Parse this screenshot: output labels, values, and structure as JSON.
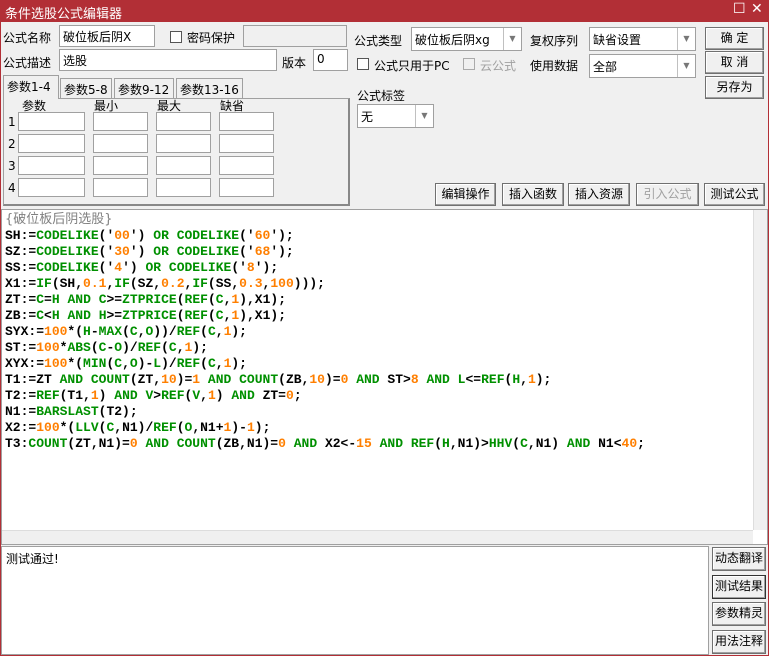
{
  "window": {
    "title": "条件选股公式编辑器"
  },
  "form": {
    "name_label": "公式名称",
    "name_value": "破位板后阴X",
    "password_label": "密码保护",
    "desc_label": "公式描述",
    "desc_value": "选股",
    "version_label": "版本",
    "version_value": "0",
    "type_label": "公式类型",
    "type_value": "破位板后阴xg",
    "pc_only_label": "公式只用于PC",
    "cloud_label": "云公式",
    "rights_label": "复权序列",
    "rights_value": "缺省设置",
    "data_label": "使用数据",
    "data_value": "全部",
    "tag_label": "公式标签",
    "tag_value": "无"
  },
  "buttons": {
    "ok": "确  定",
    "cancel": "取  消",
    "save_as": "另存为",
    "edit_ops": "编辑操作",
    "insert_func": "插入函数",
    "insert_res": "插入资源",
    "import": "引入公式",
    "test": "测试公式"
  },
  "params": {
    "tabs": [
      "参数1-4",
      "参数5-8",
      "参数9-12",
      "参数13-16"
    ],
    "headers": [
      "参数",
      "最小",
      "最大",
      "缺省"
    ],
    "rows": [
      "1",
      "2",
      "3",
      "4"
    ]
  },
  "editor": {
    "lines": [
      [
        [
          "{破位板后阴选股}",
          "c"
        ]
      ],
      [
        [
          "SH:=",
          "d"
        ],
        [
          "CODELIKE",
          "f"
        ],
        [
          "('",
          "d"
        ],
        [
          "00",
          "n"
        ],
        [
          "') ",
          "d"
        ],
        [
          "OR",
          "f"
        ],
        [
          " ",
          "d"
        ],
        [
          "CODELIKE",
          "f"
        ],
        [
          "('",
          "d"
        ],
        [
          "60",
          "n"
        ],
        [
          "');",
          "d"
        ]
      ],
      [
        [
          "SZ:=",
          "d"
        ],
        [
          "CODELIKE",
          "f"
        ],
        [
          "('",
          "d"
        ],
        [
          "30",
          "n"
        ],
        [
          "') ",
          "d"
        ],
        [
          "OR",
          "f"
        ],
        [
          " ",
          "d"
        ],
        [
          "CODELIKE",
          "f"
        ],
        [
          "('",
          "d"
        ],
        [
          "68",
          "n"
        ],
        [
          "');",
          "d"
        ]
      ],
      [
        [
          "SS:=",
          "d"
        ],
        [
          "CODELIKE",
          "f"
        ],
        [
          "('",
          "d"
        ],
        [
          "4",
          "n"
        ],
        [
          "') ",
          "d"
        ],
        [
          "OR",
          "f"
        ],
        [
          " ",
          "d"
        ],
        [
          "CODELIKE",
          "f"
        ],
        [
          "('",
          "d"
        ],
        [
          "8",
          "n"
        ],
        [
          "');",
          "d"
        ]
      ],
      [
        [
          "X1:=",
          "d"
        ],
        [
          "IF",
          "f"
        ],
        [
          "(SH,",
          "d"
        ],
        [
          "0.1",
          "n"
        ],
        [
          ",",
          "d"
        ],
        [
          "IF",
          "f"
        ],
        [
          "(SZ,",
          "d"
        ],
        [
          "0.2",
          "n"
        ],
        [
          ",",
          "d"
        ],
        [
          "IF",
          "f"
        ],
        [
          "(SS,",
          "d"
        ],
        [
          "0.3",
          "n"
        ],
        [
          ",",
          "d"
        ],
        [
          "100",
          "n"
        ],
        [
          ")));",
          "d"
        ]
      ],
      [
        [
          "ZT:=",
          "d"
        ],
        [
          "C",
          "f"
        ],
        [
          "=",
          "d"
        ],
        [
          "H",
          "f"
        ],
        [
          " ",
          "d"
        ],
        [
          "AND",
          "f"
        ],
        [
          " ",
          "d"
        ],
        [
          "C",
          "f"
        ],
        [
          ">=",
          "d"
        ],
        [
          "ZTPRICE",
          "f"
        ],
        [
          "(",
          "d"
        ],
        [
          "REF",
          "f"
        ],
        [
          "(",
          "d"
        ],
        [
          "C",
          "f"
        ],
        [
          ",",
          "d"
        ],
        [
          "1",
          "n"
        ],
        [
          "),X1);",
          "d"
        ]
      ],
      [
        [
          "ZB:=",
          "d"
        ],
        [
          "C",
          "f"
        ],
        [
          "<",
          "d"
        ],
        [
          "H",
          "f"
        ],
        [
          " ",
          "d"
        ],
        [
          "AND",
          "f"
        ],
        [
          " ",
          "d"
        ],
        [
          "H",
          "f"
        ],
        [
          ">=",
          "d"
        ],
        [
          "ZTPRICE",
          "f"
        ],
        [
          "(",
          "d"
        ],
        [
          "REF",
          "f"
        ],
        [
          "(",
          "d"
        ],
        [
          "C",
          "f"
        ],
        [
          ",",
          "d"
        ],
        [
          "1",
          "n"
        ],
        [
          "),X1);",
          "d"
        ]
      ],
      [
        [
          "SYX:=",
          "d"
        ],
        [
          "100",
          "n"
        ],
        [
          "*(",
          "d"
        ],
        [
          "H",
          "f"
        ],
        [
          "-",
          "d"
        ],
        [
          "MAX",
          "f"
        ],
        [
          "(",
          "d"
        ],
        [
          "C",
          "f"
        ],
        [
          ",",
          "d"
        ],
        [
          "O",
          "f"
        ],
        [
          "))/",
          "d"
        ],
        [
          "REF",
          "f"
        ],
        [
          "(",
          "d"
        ],
        [
          "C",
          "f"
        ],
        [
          ",",
          "d"
        ],
        [
          "1",
          "n"
        ],
        [
          ");",
          "d"
        ]
      ],
      [
        [
          "ST:=",
          "d"
        ],
        [
          "100",
          "n"
        ],
        [
          "*",
          "d"
        ],
        [
          "ABS",
          "f"
        ],
        [
          "(",
          "d"
        ],
        [
          "C",
          "f"
        ],
        [
          "-",
          "d"
        ],
        [
          "O",
          "f"
        ],
        [
          ")/",
          "d"
        ],
        [
          "REF",
          "f"
        ],
        [
          "(",
          "d"
        ],
        [
          "C",
          "f"
        ],
        [
          ",",
          "d"
        ],
        [
          "1",
          "n"
        ],
        [
          ");",
          "d"
        ]
      ],
      [
        [
          "XYX:=",
          "d"
        ],
        [
          "100",
          "n"
        ],
        [
          "*(",
          "d"
        ],
        [
          "MIN",
          "f"
        ],
        [
          "(",
          "d"
        ],
        [
          "C",
          "f"
        ],
        [
          ",",
          "d"
        ],
        [
          "O",
          "f"
        ],
        [
          ")-",
          "d"
        ],
        [
          "L",
          "f"
        ],
        [
          ")/",
          "d"
        ],
        [
          "REF",
          "f"
        ],
        [
          "(",
          "d"
        ],
        [
          "C",
          "f"
        ],
        [
          ",",
          "d"
        ],
        [
          "1",
          "n"
        ],
        [
          ");",
          "d"
        ]
      ],
      [
        [
          "T1:=ZT ",
          "d"
        ],
        [
          "AND",
          "f"
        ],
        [
          " ",
          "d"
        ],
        [
          "COUNT",
          "f"
        ],
        [
          "(ZT,",
          "d"
        ],
        [
          "10",
          "n"
        ],
        [
          ")=",
          "d"
        ],
        [
          "1",
          "n"
        ],
        [
          " ",
          "d"
        ],
        [
          "AND",
          "f"
        ],
        [
          " ",
          "d"
        ],
        [
          "COUNT",
          "f"
        ],
        [
          "(ZB,",
          "d"
        ],
        [
          "10",
          "n"
        ],
        [
          ")=",
          "d"
        ],
        [
          "0",
          "n"
        ],
        [
          " ",
          "d"
        ],
        [
          "AND",
          "f"
        ],
        [
          " ST>",
          "d"
        ],
        [
          "8",
          "n"
        ],
        [
          " ",
          "d"
        ],
        [
          "AND",
          "f"
        ],
        [
          " ",
          "d"
        ],
        [
          "L",
          "f"
        ],
        [
          "<=",
          "d"
        ],
        [
          "REF",
          "f"
        ],
        [
          "(",
          "d"
        ],
        [
          "H",
          "f"
        ],
        [
          ",",
          "d"
        ],
        [
          "1",
          "n"
        ],
        [
          ");",
          "d"
        ]
      ],
      [
        [
          "T2:=",
          "d"
        ],
        [
          "REF",
          "f"
        ],
        [
          "(T1,",
          "d"
        ],
        [
          "1",
          "n"
        ],
        [
          ") ",
          "d"
        ],
        [
          "AND",
          "f"
        ],
        [
          " ",
          "d"
        ],
        [
          "V",
          "f"
        ],
        [
          ">",
          "d"
        ],
        [
          "REF",
          "f"
        ],
        [
          "(",
          "d"
        ],
        [
          "V",
          "f"
        ],
        [
          ",",
          "d"
        ],
        [
          "1",
          "n"
        ],
        [
          ") ",
          "d"
        ],
        [
          "AND",
          "f"
        ],
        [
          " ZT=",
          "d"
        ],
        [
          "0",
          "n"
        ],
        [
          ";",
          "d"
        ]
      ],
      [
        [
          "N1:=",
          "d"
        ],
        [
          "BARSLAST",
          "f"
        ],
        [
          "(T2);",
          "d"
        ]
      ],
      [
        [
          "X2:=",
          "d"
        ],
        [
          "100",
          "n"
        ],
        [
          "*(",
          "d"
        ],
        [
          "LLV",
          "f"
        ],
        [
          "(",
          "d"
        ],
        [
          "C",
          "f"
        ],
        [
          ",N1)/",
          "d"
        ],
        [
          "REF",
          "f"
        ],
        [
          "(",
          "d"
        ],
        [
          "O",
          "f"
        ],
        [
          ",N1+",
          "d"
        ],
        [
          "1",
          "n"
        ],
        [
          ")-",
          "d"
        ],
        [
          "1",
          "n"
        ],
        [
          ");",
          "d"
        ]
      ],
      [
        [
          "T3:",
          "d"
        ],
        [
          "COUNT",
          "f"
        ],
        [
          "(ZT,N1)=",
          "d"
        ],
        [
          "0",
          "n"
        ],
        [
          " ",
          "d"
        ],
        [
          "AND",
          "f"
        ],
        [
          " ",
          "d"
        ],
        [
          "COUNT",
          "f"
        ],
        [
          "(ZB,N1)=",
          "d"
        ],
        [
          "0",
          "n"
        ],
        [
          " ",
          "d"
        ],
        [
          "AND",
          "f"
        ],
        [
          " X2<-",
          "d"
        ],
        [
          "15",
          "n"
        ],
        [
          " ",
          "d"
        ],
        [
          "AND",
          "f"
        ],
        [
          " ",
          "d"
        ],
        [
          "REF",
          "f"
        ],
        [
          "(",
          "d"
        ],
        [
          "H",
          "f"
        ],
        [
          ",N1)>",
          "d"
        ],
        [
          "HHV",
          "f"
        ],
        [
          "(",
          "d"
        ],
        [
          "C",
          "f"
        ],
        [
          ",N1) ",
          "d"
        ],
        [
          "AND",
          "f"
        ],
        [
          " N1<",
          "d"
        ],
        [
          "40",
          "n"
        ],
        [
          ";",
          "d"
        ]
      ]
    ]
  },
  "result": {
    "text": "测试通过!"
  },
  "side_buttons": [
    "动态翻译",
    "测试结果",
    "参数精灵",
    "用法注释"
  ],
  "colors": {
    "titlebar": "#b22f36",
    "function": "#009000",
    "number": "#ff7f00",
    "comment": "#808080"
  }
}
